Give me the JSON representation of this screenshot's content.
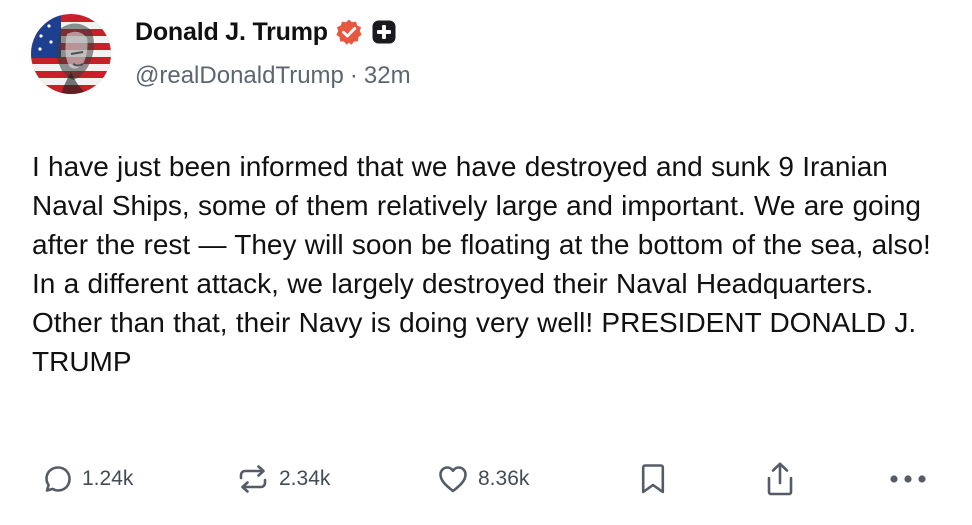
{
  "post": {
    "author": {
      "display_name": "Donald J. Trump",
      "handle": "@realDonaldTrump",
      "separator": "·",
      "time_ago": "32m",
      "avatar_icon": "flag-portrait-avatar",
      "verified_icon": "verified-badge-icon",
      "verified_color": "#e8573f",
      "extra_badge_icon": "plus-badge-icon"
    },
    "body": "I have just been informed that we have destroyed and sunk 9 Iranian Naval Ships, some of them relatively large and important. We are going after the rest — They will soon be floating at the bottom of the sea, also! In a different attack, we largely destroyed their Naval Headquarters. Other than that, their Navy is doing very well! PRESIDENT DONALD J. TRUMP",
    "actions": {
      "reply_count": "1.24k",
      "repost_count": "2.34k",
      "like_count": "8.36k",
      "reply_icon": "reply-bubble-icon",
      "repost_icon": "repost-arrows-icon",
      "like_icon": "heart-icon",
      "bookmark_icon": "bookmark-icon",
      "share_icon": "share-upload-icon",
      "more_icon": "more-dots-icon"
    }
  }
}
